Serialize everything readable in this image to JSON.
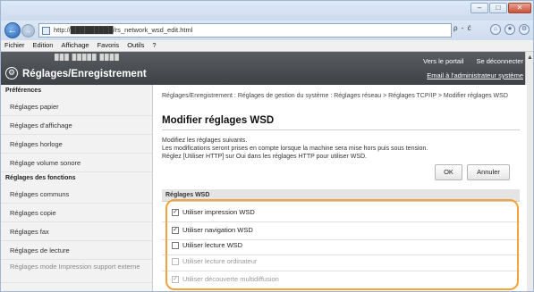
{
  "browser": {
    "address": "http://█████████/rs_network_wsd_edit.html",
    "address_tools": "ρ - ć",
    "menu": [
      "Fichier",
      "Edition",
      "Affichage",
      "Favoris",
      "Outils",
      "?"
    ]
  },
  "header": {
    "device_name": "███ █████  ████",
    "title": "Réglages/Enregistrement",
    "portal_link": "Vers le portail",
    "logout_link": "Se déconnecter",
    "mail_link": "Email à l'administrateur système"
  },
  "sidebar": {
    "preferences_heading": "Préférences",
    "preferences": [
      "Réglages papier",
      "Réglages d'affichage",
      "Réglages horloge",
      "Réglage volume sonore"
    ],
    "functions_heading": "Réglages des fonctions",
    "functions": [
      "Réglages communs",
      "Réglages copie",
      "Réglages fax",
      "Réglages de lecture",
      "Réglages mode Impression support externe"
    ]
  },
  "main": {
    "breadcrumb": "Réglages/Enregistrement : Réglages de gestion du système : Réglages réseau > Réglages TCP/IP > Modifier réglages WSD",
    "title": "Modifier réglages WSD",
    "desc1": "Modifiez les réglages suivants.",
    "desc2": "Les modifications seront prises en compte lorsque la machine sera mise hors puis sous tension.",
    "desc3": "Réglez [Utiliser HTTP] sur Oui dans les réglages HTTP pour utiliser WSD.",
    "ok_label": "OK",
    "cancel_label": "Annuler",
    "section": "Réglages WSD",
    "options": [
      {
        "label": "Utiliser impression WSD",
        "checked": true,
        "enabled": true
      },
      {
        "label": "Utiliser navigation WSD",
        "checked": true,
        "enabled": true
      },
      {
        "label": "Utiliser lecture WSD",
        "checked": false,
        "enabled": true
      },
      {
        "label": "Utiliser lecture ordinateur",
        "checked": false,
        "enabled": false
      },
      {
        "label": "Utiliser découverte multidiffusion",
        "checked": true,
        "enabled": false
      }
    ]
  },
  "colors": {
    "highlight": "#f2a33a",
    "header_bg": "#4a4e53"
  }
}
